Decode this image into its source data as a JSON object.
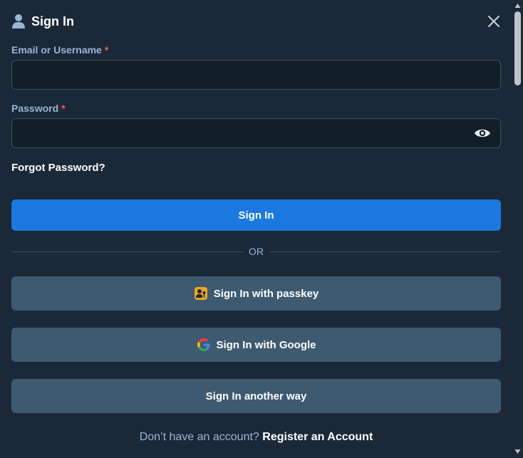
{
  "dialog": {
    "title": "Sign In",
    "icons": {
      "title": "user-icon",
      "close": "close-icon"
    }
  },
  "form": {
    "email_label": "Email or Username",
    "email_value": "",
    "password_label": "Password",
    "password_value": "",
    "required_marker": "*",
    "forgot_link": "Forgot Password?",
    "submit_label": "Sign In",
    "divider_text": "OR"
  },
  "alternatives": {
    "passkey_label": "Sign In with passkey",
    "google_label": "Sign In with Google",
    "other_label": "Sign In another way"
  },
  "footer": {
    "question": "Don’t have an account?",
    "register_link": "Register an Account"
  },
  "colors": {
    "background": "#1b2838",
    "primary": "#1a78e0",
    "secondary_button": "#3e5a70",
    "label": "#9ab4d6",
    "required": "#ff5a5a"
  }
}
